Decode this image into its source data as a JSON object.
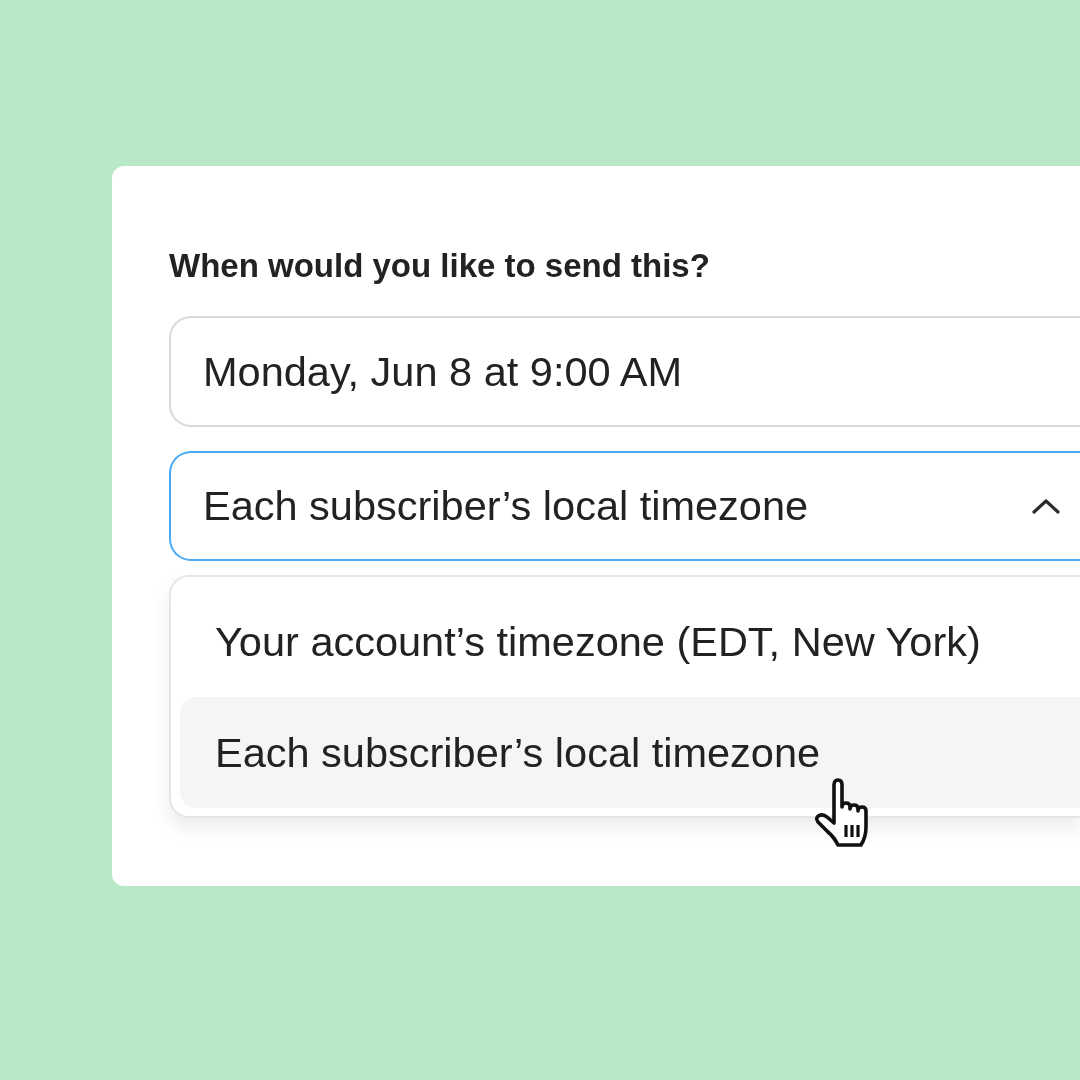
{
  "question": {
    "label": "When would you like to send this?"
  },
  "date_field": {
    "value": "Monday, Jun 8 at 9:00 AM"
  },
  "timezone_select": {
    "value": "Each subscriber’s local timezone",
    "expanded": true
  },
  "options": [
    {
      "label": "Your account’s timezone (EDT, New York)",
      "selected": false
    },
    {
      "label": "Each subscriber’s local timezone",
      "selected": true
    }
  ]
}
